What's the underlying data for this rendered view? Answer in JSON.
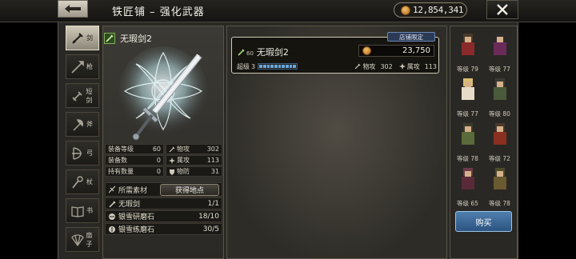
{
  "header": {
    "title": "铁匠铺 – 强化武器",
    "gold": "12,854,341"
  },
  "categories": [
    {
      "label": "剑",
      "icon": "sword-icon",
      "active": true
    },
    {
      "label": "枪",
      "icon": "spear-icon",
      "active": false
    },
    {
      "label": "短剑",
      "icon": "dagger-icon",
      "active": false
    },
    {
      "label": "斧",
      "icon": "axe-icon",
      "active": false
    },
    {
      "label": "弓",
      "icon": "bow-icon",
      "active": false
    },
    {
      "label": "杖",
      "icon": "staff-icon",
      "active": false
    },
    {
      "label": "书",
      "icon": "book-icon",
      "active": false
    },
    {
      "label": "扇子",
      "icon": "fan-icon",
      "active": false
    }
  ],
  "weapon": {
    "name": "无瑕剑2",
    "stats": [
      {
        "label": "装备等级",
        "value": "60",
        "stat_label": "物攻",
        "stat_value": "302"
      },
      {
        "label": "装备数",
        "value": "0",
        "stat_label": "属攻",
        "stat_value": "113"
      },
      {
        "label": "持有数量",
        "value": "0",
        "stat_label": "物防",
        "stat_value": "31"
      }
    ]
  },
  "materials": {
    "header_label": "所需素材",
    "get_button_label": "获得地点",
    "items": [
      {
        "name": "无瑕剑",
        "count": "1/1"
      },
      {
        "name": "银雪研磨石",
        "count": "18/10"
      },
      {
        "name": "银雪练磨石",
        "count": "30/5"
      }
    ]
  },
  "shop_card": {
    "tag": "店铺限定",
    "level": "60",
    "name": "无瑕剑2",
    "price": "23,750",
    "skill_label": "超级",
    "skill_num": "3",
    "stat1_label": "物攻",
    "stat1_value": "302",
    "stat2_label": "属攻",
    "stat2_value": "113"
  },
  "roster": [
    {
      "level": "等级 79"
    },
    {
      "level": "等级 77"
    },
    {
      "level": "等级 77"
    },
    {
      "level": "等级 80"
    },
    {
      "level": "等级 78"
    },
    {
      "level": "等级 72"
    },
    {
      "level": "等级 65"
    },
    {
      "level": "等级 78"
    }
  ],
  "buy_label": "购买"
}
